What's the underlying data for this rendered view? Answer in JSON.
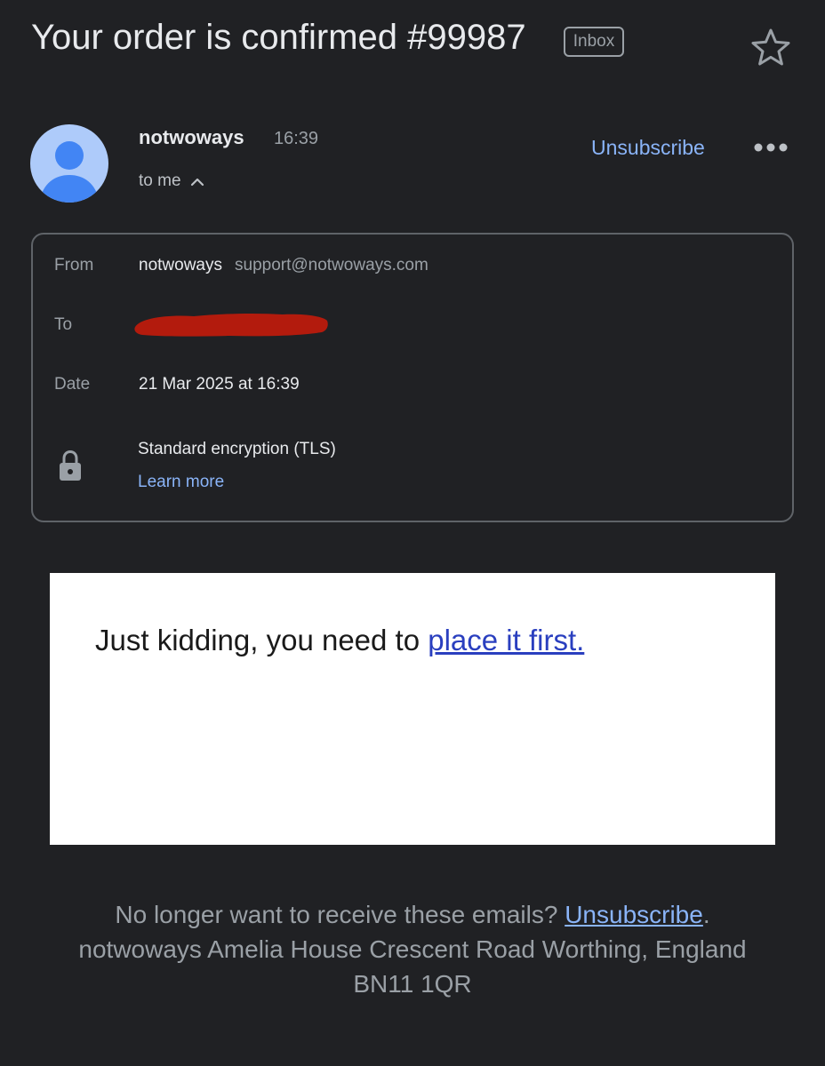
{
  "email": {
    "subject": "Your order is confirmed #99987",
    "label": "Inbox"
  },
  "sender": {
    "name": "notwoways",
    "time": "16:39",
    "recipient_summary": "to me",
    "unsubscribe_label": "Unsubscribe"
  },
  "details": {
    "from_label": "From",
    "from_name": "notwoways",
    "from_email": "support@notwoways.com",
    "to_label": "To",
    "date_label": "Date",
    "date_value": "21 Mar 2025 at 16:39",
    "encryption_text": "Standard encryption (TLS)",
    "learn_more_label": "Learn more"
  },
  "message": {
    "text_prefix": "Just kidding, you need to ",
    "link_text": "place it first."
  },
  "footer": {
    "prompt": "No longer want to receive these emails? ",
    "unsubscribe_label": "Unsubscribe",
    "period": ".",
    "address": "notwoways Amelia House Crescent Road Worthing, England BN11 1QR"
  },
  "icons": {
    "star": "star-icon",
    "more": "more-horizontal-icon",
    "chevron": "chevron-up-icon",
    "lock": "lock-icon",
    "avatar": "default-person-avatar"
  },
  "colors": {
    "background": "#202124",
    "link": "#8ab4f8",
    "redaction": "#b31b0d",
    "avatar_bg": "#aecbfa",
    "avatar_fg": "#4285f4"
  }
}
